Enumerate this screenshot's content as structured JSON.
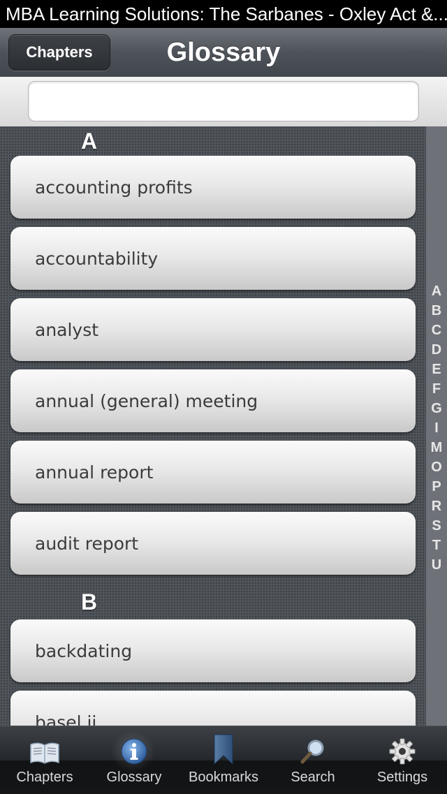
{
  "window": {
    "title": "MBA Learning Solutions: The Sarbanes - Oxley Act &..."
  },
  "navbar": {
    "back_label": "Chapters",
    "title": "Glossary"
  },
  "search": {
    "placeholder": ""
  },
  "index_letters": [
    "A",
    "B",
    "C",
    "D",
    "E",
    "F",
    "G",
    "I",
    "M",
    "O",
    "P",
    "R",
    "S",
    "T",
    "U"
  ],
  "sections": [
    {
      "letter": "A",
      "items": [
        "accounting profits",
        "accountability",
        "analyst",
        "annual (general) meeting",
        "annual report",
        "audit report"
      ]
    },
    {
      "letter": "B",
      "items": [
        "backdating",
        "basel ii"
      ]
    }
  ],
  "tabs": [
    {
      "label": "Chapters",
      "icon": "book-icon",
      "active": false
    },
    {
      "label": "Glossary",
      "icon": "info-icon",
      "active": true
    },
    {
      "label": "Bookmarks",
      "icon": "bookmark-icon",
      "active": false
    },
    {
      "label": "Search",
      "icon": "magnifier-icon",
      "active": false
    },
    {
      "label": "Settings",
      "icon": "gear-icon",
      "active": false
    }
  ]
}
